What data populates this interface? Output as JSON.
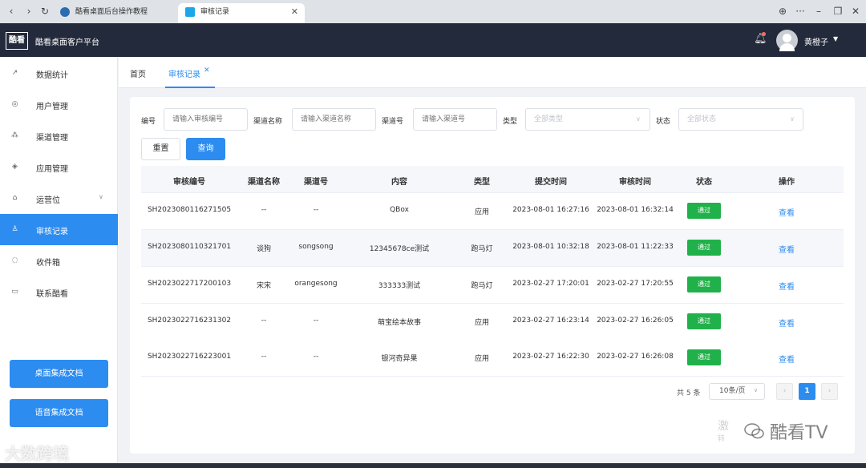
{
  "browser": {
    "tabs": [
      {
        "title": "酷看桌面后台操作教程",
        "active": false
      },
      {
        "title": "审核记录",
        "active": true
      }
    ],
    "nav": {
      "back": "‹",
      "forward": "›",
      "reload": "↻"
    },
    "controls": {
      "globe": "⊕",
      "more": "···",
      "minimize": "–",
      "restore": "❐",
      "close": "✕"
    }
  },
  "header": {
    "logo_text": "酷看",
    "app_title": "酷看桌面客户平台",
    "user_name": "黄橙子",
    "bell_icon": "bell-icon"
  },
  "sidebar": {
    "items": [
      {
        "label": "数据统计",
        "icon": "chart-icon",
        "glyph": "↗"
      },
      {
        "label": "用户管理",
        "icon": "user-icon",
        "glyph": "◎"
      },
      {
        "label": "渠道管理",
        "icon": "channel-icon",
        "glyph": "⁂"
      },
      {
        "label": "应用管理",
        "icon": "layers-icon",
        "glyph": "◈"
      },
      {
        "label": "运营位",
        "icon": "operation-icon",
        "glyph": "⌂",
        "has_arrow": true
      },
      {
        "label": "审核记录",
        "icon": "audit-icon",
        "glyph": "♙",
        "active": true
      },
      {
        "label": "收件箱",
        "icon": "inbox-icon",
        "glyph": "◌"
      },
      {
        "label": "联系酷看",
        "icon": "contact-icon",
        "glyph": "▭"
      }
    ],
    "doc_buttons": [
      "桌面集成文档",
      "语音集成文档"
    ]
  },
  "page_tabs": {
    "home": "首页",
    "current": "审核记录"
  },
  "filters": {
    "fields": [
      {
        "label": "编号",
        "placeholder": "请输入审核编号"
      },
      {
        "label": "渠道名称",
        "placeholder": "请输入渠道名称"
      },
      {
        "label": "渠道号",
        "placeholder": "请输入渠道号"
      },
      {
        "label": "类型",
        "placeholder": "全部类型"
      },
      {
        "label": "状态",
        "placeholder": "全部状态"
      }
    ],
    "reset_label": "重置",
    "query_label": "查询"
  },
  "table": {
    "columns": [
      "审核编号",
      "渠道名称",
      "渠道号",
      "内容",
      "类型",
      "提交时间",
      "审核时间",
      "状态",
      "操作"
    ],
    "rows": [
      {
        "id": "SH2023080116271505",
        "channel_name": "--",
        "channel_no": "--",
        "content": "QBox",
        "type": "应用",
        "submit_time": "2023-08-01 16:27:16",
        "audit_time": "2023-08-01 16:32:14",
        "status": "通过",
        "action": "查看"
      },
      {
        "id": "SH2023080110321701",
        "channel_name": "谈狗",
        "channel_no": "songsong",
        "content": "12345678ce测试",
        "type": "跑马灯",
        "submit_time": "2023-08-01 10:32:18",
        "audit_time": "2023-08-01 11:22:33",
        "status": "通过",
        "action": "查看"
      },
      {
        "id": "SH2023022717200103",
        "channel_name": "宋宋",
        "channel_no": "orangesong",
        "content": "333333测试",
        "type": "跑马灯",
        "submit_time": "2023-02-27 17:20:01",
        "audit_time": "2023-02-27 17:20:55",
        "status": "通过",
        "action": "查看"
      },
      {
        "id": "SH2023022716231302",
        "channel_name": "--",
        "channel_no": "--",
        "content": "萌宝绘本故事",
        "type": "应用",
        "submit_time": "2023-02-27 16:23:14",
        "audit_time": "2023-02-27 16:26:05",
        "status": "通过",
        "action": "查看"
      },
      {
        "id": "SH2023022716223001",
        "channel_name": "--",
        "channel_no": "--",
        "content": "银河奇异果",
        "type": "应用",
        "submit_time": "2023-02-27 16:22:30",
        "audit_time": "2023-02-27 16:26:08",
        "status": "通过",
        "action": "查看"
      }
    ]
  },
  "pagination": {
    "total": "共 5 条",
    "page_size": "10条/页",
    "current_page": "1",
    "prev": "‹",
    "next": "›"
  },
  "watermarks": {
    "left": "大数跨境",
    "right": "酷看TV"
  },
  "colors": {
    "primary": "#2d8cf0",
    "header_bg": "#232a3b",
    "status_pass": "#21b14a"
  }
}
